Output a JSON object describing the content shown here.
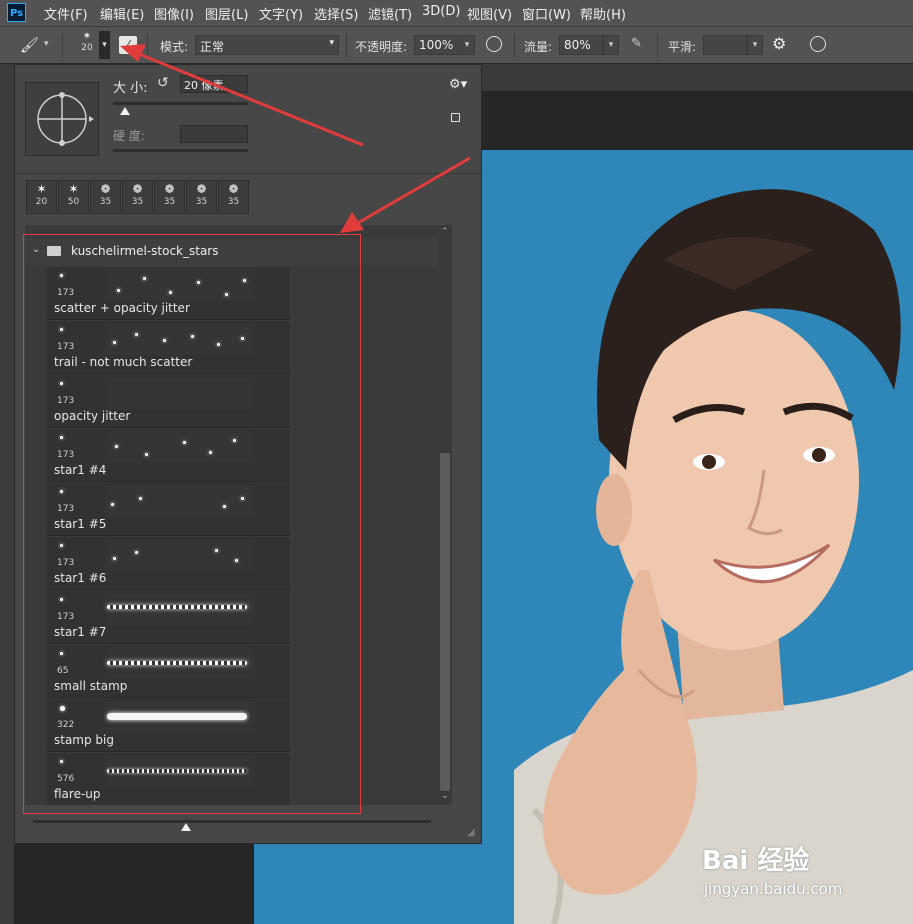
{
  "app": {
    "logo": "Ps"
  },
  "menu": [
    "文件(F)",
    "编辑(E)",
    "图像(I)",
    "图层(L)",
    "文字(Y)",
    "选择(S)",
    "滤镜(T)",
    "3D(D)",
    "视图(V)",
    "窗口(W)",
    "帮助(H)"
  ],
  "options": {
    "brush_size_preview": "20",
    "mode_label": "模式:",
    "mode_value": "正常",
    "opacity_label": "不透明度:",
    "opacity_value": "100%",
    "flow_label": "流量:",
    "flow_value": "80%",
    "smooth_label": "平滑:",
    "smooth_value": ""
  },
  "panel": {
    "size_label": "大 小:",
    "size_value": "20 像素",
    "hardness_label": "硬 度:",
    "hardness_value": "",
    "recent_tips": [
      {
        "icon": "✶",
        "size": "20"
      },
      {
        "icon": "✶",
        "size": "50"
      },
      {
        "icon": "❁",
        "size": "35"
      },
      {
        "icon": "❁",
        "size": "35"
      },
      {
        "icon": "❁",
        "size": "35"
      },
      {
        "icon": "❁",
        "size": "35"
      },
      {
        "icon": "❁",
        "size": "35"
      }
    ],
    "folder_name": "kuschelirmel-stock_stars",
    "brushes": [
      {
        "size": "173",
        "name": "scatter + opacity jitter"
      },
      {
        "size": "173",
        "name": "trail - not much scatter"
      },
      {
        "size": "173",
        "name": "opacity jitter"
      },
      {
        "size": "173",
        "name": "star1 #4"
      },
      {
        "size": "173",
        "name": "star1 #5"
      },
      {
        "size": "173",
        "name": "star1 #6"
      },
      {
        "size": "173",
        "name": "star1 #7"
      },
      {
        "size": "65",
        "name": "small stamp"
      },
      {
        "size": "322",
        "name": "stamp big"
      },
      {
        "size": "576",
        "name": "flare-up"
      }
    ]
  },
  "watermark": {
    "brand": "Bai 经验",
    "url": "jingyan.baidu.com"
  },
  "colors": {
    "accent_red": "#e03c3c",
    "canvas_blue": "#2f85b8"
  }
}
